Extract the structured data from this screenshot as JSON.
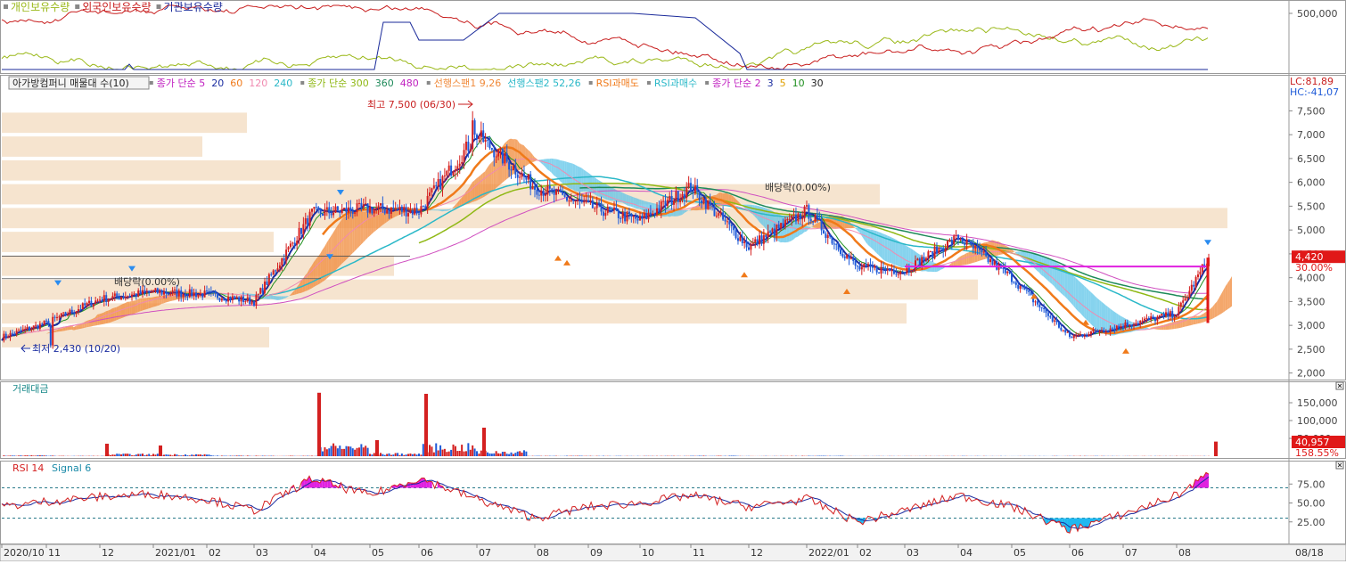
{
  "colors": {
    "individual": "#9ab818",
    "foreign": "#c81e1e",
    "institution": "#1a2a9a",
    "up_candle": "#d42020",
    "down_candle": "#1e5ad8",
    "ma5": "#1a2ca0",
    "ma20": "#1e8f1e",
    "ma60": "#f07a1a",
    "ma120": "#f08ab0",
    "ma240": "#2ab8c8",
    "ma300": "#8fb814",
    "ma360": "#1e8a5a",
    "ma480": "#d050c0",
    "span1": "#f08a3a",
    "span2": "#5ec4e8",
    "rsi": "#d42020",
    "signal": "#1a2ca0",
    "overbought": "#e020e0",
    "oversold": "#20b8f0",
    "volume_profile": "#f6e4cf",
    "last_price": "#e01818"
  },
  "top_panel": {
    "legend": [
      {
        "label": "개인보유수량",
        "color": "#9ab818"
      },
      {
        "label": "외국인보유수량",
        "color": "#c81e1e"
      },
      {
        "label": "기관보유수량",
        "color": "#1a2a9a"
      }
    ],
    "axis_label": "500,000"
  },
  "main_panel": {
    "indicator_legend": [
      {
        "label": "아가방컴퍼니 매물대 수(10)",
        "color": "#222222",
        "boxed": true
      },
      {
        "label": "종가 단순 5",
        "color": "#c020c0"
      },
      {
        "label": "20",
        "color": "#1a2ca0"
      },
      {
        "label": "60",
        "color": "#f07a1a"
      },
      {
        "label": "120",
        "color": "#f08ab0"
      },
      {
        "label": "240",
        "color": "#2ab8c8"
      },
      {
        "label": "종가 단순 300",
        "color": "#8fb814"
      },
      {
        "label": "360",
        "color": "#1e8a5a"
      },
      {
        "label": "480",
        "color": "#c020c0"
      },
      {
        "label": "선행스팬1 9,26",
        "color": "#f08a3a"
      },
      {
        "label": "선행스팬2 52,26",
        "color": "#2ab8c8"
      },
      {
        "label": "RSI과매도",
        "color": "#f07a1a"
      },
      {
        "label": "RSI과매수",
        "color": "#2ab8c8"
      },
      {
        "label": "종가 단순 2",
        "color": "#c020c0"
      },
      {
        "label": "3",
        "color": "#1a2ca0"
      },
      {
        "label": "5",
        "color": "#e0a000"
      },
      {
        "label": "10",
        "color": "#1e8f1e"
      },
      {
        "label": "30",
        "color": "#222222"
      }
    ],
    "lc_label": "LC:81,89",
    "hc_label": "HC:-41,07",
    "high_annotation": "최고 7,500 (06/30)",
    "low_annotation": "최저 2,430 (10/20)",
    "dividend_annotations": [
      "배당락(0.00%)",
      "배당락(0.00%)"
    ],
    "price_ticks": [
      "7,500",
      "7,000",
      "6,500",
      "6,000",
      "5,500",
      "5,000",
      "4,500",
      "4,000",
      "3,500",
      "3,000",
      "2,500",
      "2,000"
    ],
    "last_price_label": "4,420",
    "last_change_label": "30.00%"
  },
  "volume_panel": {
    "title": "거래대금",
    "ticks": [
      "150,000",
      "100,000",
      "50,000"
    ],
    "last_value_label": "40,957",
    "last_change_label": "158.55%"
  },
  "rsi_panel": {
    "title_rsi": "RSI 14",
    "title_signal": "Signal 6",
    "ticks": [
      "75.00",
      "50.00",
      "25.00"
    ],
    "overbought_level": 70,
    "oversold_level": 30
  },
  "x_axis": {
    "labels": [
      "2020/10",
      "11",
      "12",
      "2021/01",
      "02",
      "03",
      "04",
      "05",
      "06",
      "07",
      "08",
      "09",
      "10",
      "11",
      "12",
      "2022/01",
      "02",
      "03",
      "04",
      "05",
      "06",
      "07",
      "08"
    ],
    "right_label": "08/18"
  },
  "chart_data": {
    "type": "candlestick",
    "title": "아가방컴퍼니",
    "x": [
      "2020/10",
      "11",
      "12",
      "2021/01",
      "02",
      "03",
      "04",
      "05",
      "06",
      "07",
      "08",
      "09",
      "10",
      "11",
      "12",
      "2022/01",
      "02",
      "03",
      "04",
      "05",
      "06",
      "07",
      "08",
      "08/18"
    ],
    "close": [
      2750,
      3050,
      3550,
      3700,
      3650,
      3500,
      5350,
      5450,
      5400,
      7000,
      5900,
      5500,
      5200,
      5900,
      4650,
      5400,
      4200,
      4150,
      4850,
      4000,
      2750,
      3000,
      3250,
      4420
    ],
    "high_point": {
      "label": "최고",
      "value": 7500,
      "date": "06/30"
    },
    "low_point": {
      "label": "최저",
      "value": 2430,
      "date": "10/20"
    },
    "ylim": [
      1900,
      7900
    ],
    "volume": {
      "title": "거래대금",
      "values": [
        12000,
        5000,
        35000,
        30000,
        8000,
        6000,
        178000,
        45000,
        175000,
        80000,
        6000,
        5000,
        4000,
        7000,
        4000,
        6000,
        3000,
        3000,
        4000,
        3000,
        4000,
        3000,
        3500,
        40957
      ],
      "ylim": [
        0,
        190000
      ]
    },
    "rsi": {
      "period": 14,
      "signal_period": 6,
      "values": [
        45,
        52,
        58,
        62,
        55,
        40,
        82,
        60,
        83,
        55,
        30,
        45,
        50,
        60,
        45,
        55,
        25,
        40,
        60,
        45,
        15,
        35,
        60,
        88
      ],
      "ylim": [
        0,
        100
      ]
    }
  }
}
